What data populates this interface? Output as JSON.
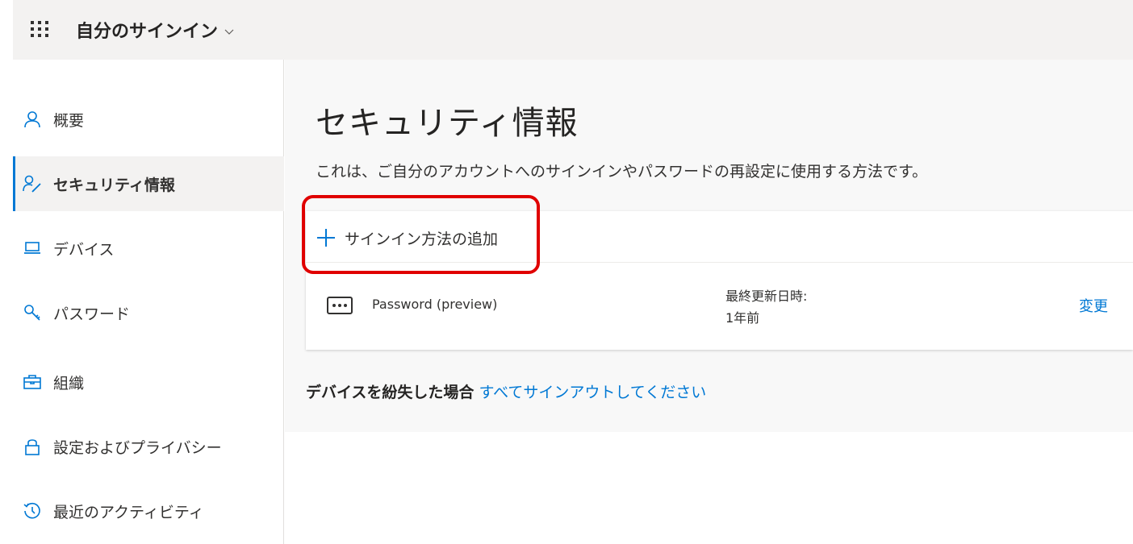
{
  "header": {
    "app_title": "自分のサインイン",
    "waffle_icon": "waffle-icon",
    "dropdown_icon": "chevron-down-icon"
  },
  "sidebar": {
    "items": [
      {
        "label": "概要",
        "icon": "person-icon",
        "active": false
      },
      {
        "label": "セキュリティ情報",
        "icon": "security-info-icon",
        "active": true
      },
      {
        "label": "デバイス",
        "icon": "laptop-icon",
        "active": false
      },
      {
        "label": "パスワード",
        "icon": "key-icon",
        "active": false
      },
      {
        "label": "組織",
        "icon": "briefcase-icon",
        "active": false
      },
      {
        "label": "設定およびプライバシー",
        "icon": "lock-icon",
        "active": false
      },
      {
        "label": "最近のアクティビティ",
        "icon": "history-icon",
        "active": false
      }
    ]
  },
  "main": {
    "title": "セキュリティ情報",
    "description": "これは、ご自分のアカウントへのサインインやパスワードの再設定に使用する方法です。",
    "add_method_label": "サインイン方法の追加",
    "methods": [
      {
        "icon": "password-dots-icon",
        "name": "Password (preview)",
        "updated_label": "最終更新日時:",
        "updated_value": "1年前",
        "action_label": "変更"
      }
    ],
    "lost_device_label": "デバイスを紛失した場合",
    "lost_device_link": "すべてサインアウトしてください"
  },
  "colors": {
    "accent": "#0078d4",
    "highlight": "#e00000",
    "topbar_bg": "#f3f2f1",
    "main_bg": "#f8f8f8"
  }
}
